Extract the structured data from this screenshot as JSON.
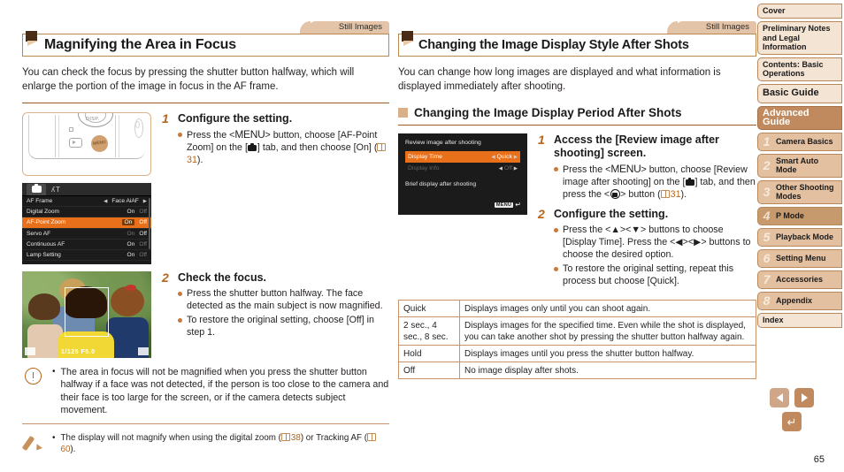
{
  "left": {
    "still_tab": "Still Images",
    "heading": "Magnifying the Area in Focus",
    "intro": "You can check the focus by pressing the shutter button halfway, which will enlarge the portion of the image in focus in the AF frame.",
    "menu_screen": {
      "tab_other": "ʎТ",
      "rows": [
        {
          "label": "AF Frame",
          "value": "Face AiAF",
          "type": "arrows"
        },
        {
          "label": "Digital Zoom",
          "on": "On",
          "off": "Off",
          "selected": "on",
          "type": "toggle"
        },
        {
          "label": "AF-Point Zoom",
          "on": "On",
          "off": "Off",
          "selected": "on",
          "type": "toggle",
          "highlight": true
        },
        {
          "label": "Servo AF",
          "on": "On",
          "off": "Off",
          "selected": "off",
          "type": "toggle"
        },
        {
          "label": "Continuous AF",
          "on": "On",
          "off": "Off",
          "selected": "on",
          "type": "toggle"
        },
        {
          "label": "Lamp Setting",
          "on": "On",
          "off": "Off",
          "selected": "on",
          "type": "toggle"
        }
      ]
    },
    "photo_osd": "1/125  F5.0",
    "steps": [
      {
        "num": "1",
        "title": "Configure the setting.",
        "bullets": [
          {
            "pre": "Press the <",
            "menu": "MENU",
            "mid": "> button, choose [AF-Point Zoom] on the [",
            "icon": "camera-tab-icon",
            "post": "] tab, and then choose [On] (",
            "pageref": "31",
            "end": ")."
          }
        ]
      },
      {
        "num": "2",
        "title": "Check the focus.",
        "bullets": [
          {
            "text": "Press the shutter button halfway. The face detected as the main subject is now magnified."
          },
          {
            "text": "To restore the original setting, choose [Off] in step 1."
          }
        ]
      }
    ],
    "warning": "The area in focus will not be magnified when you press the shutter button halfway if a face was not detected, if the person is too close to the camera and their face is too large for the screen, or if the camera detects subject movement.",
    "note": {
      "pre": "The display will not magnify when using the digital zoom (",
      "ref1": "38",
      "mid": ") or Tracking AF (",
      "ref2": "60",
      "end": ")."
    }
  },
  "right": {
    "still_tab": "Still Images",
    "heading": "Changing the Image Display Style After Shots",
    "intro": "You can change how long images are displayed and what information is displayed immediately after shooting.",
    "subheading": "Changing the Image Display Period After Shots",
    "review_screen": {
      "title": "Review image after shooting",
      "row1_label": "Display Time",
      "row1_value": "Quick",
      "row2_label": "Display Info",
      "row2_value": "Off",
      "footer": "Brief display after shooting",
      "menu_chip": "MENU"
    },
    "steps": [
      {
        "num": "1",
        "title": "Access the [Review image after shooting] screen.",
        "bullets": [
          {
            "pre": "Press the <",
            "menu": "MENU",
            "mid": "> button, choose [Review image after shooting] on the [",
            "icon": "camera-tab-icon",
            "post": "] tab, and then press the <",
            "icon2": "func-set-icon",
            "post2": "> button (",
            "pageref": "31",
            "end": ")."
          }
        ]
      },
      {
        "num": "2",
        "title": "Configure the setting.",
        "bullets": [
          {
            "text": "Press the <▲><▼> buttons to choose [Display Time]. Press the <◀><▶> buttons to choose the desired option."
          },
          {
            "text": "To restore the original setting, repeat this process but choose [Quick]."
          }
        ]
      }
    ],
    "table": [
      {
        "key": "Quick",
        "desc": "Displays images only until you can shoot again."
      },
      {
        "key": "2 sec., 4 sec., 8 sec.",
        "desc": "Displays images for the specified time. Even while the shot is displayed, you can take another shot by pressing the shutter button halfway again."
      },
      {
        "key": "Hold",
        "desc": "Displays images until you press the shutter button halfway."
      },
      {
        "key": "Off",
        "desc": "No image display after shots."
      }
    ]
  },
  "sidebar": {
    "items": [
      {
        "label": "Cover",
        "style": "plain"
      },
      {
        "label": "Preliminary Notes and Legal Information",
        "style": "plain"
      },
      {
        "label": "Contents: Basic Operations",
        "style": "plain"
      },
      {
        "label": "Basic Guide",
        "style": "big"
      },
      {
        "label": "Advanced Guide",
        "style": "head"
      }
    ],
    "chapters": [
      {
        "num": "1",
        "label": "Camera Basics",
        "active": false
      },
      {
        "num": "2",
        "label": "Smart Auto Mode",
        "active": false
      },
      {
        "num": "3",
        "label": "Other Shooting Modes",
        "active": false
      },
      {
        "num": "4",
        "label": "P Mode",
        "active": true
      },
      {
        "num": "5",
        "label": "Playback Mode",
        "active": false
      },
      {
        "num": "6",
        "label": "Setting Menu",
        "active": false
      },
      {
        "num": "7",
        "label": "Accessories",
        "active": false
      },
      {
        "num": "8",
        "label": "Appendix",
        "active": false
      }
    ],
    "index": {
      "label": "Index"
    }
  },
  "pagenav": {
    "prev_icon": "prev-page-icon",
    "next_icon": "next-page-icon",
    "back_icon": "return-icon",
    "page_number": "65"
  },
  "colors": {
    "accent": "#b5651d",
    "rule": "#9c5b20",
    "tab_bg": "#e3c4a8",
    "sidebar_active": "#c79a6e",
    "highlight_orange": "#e8701a"
  }
}
